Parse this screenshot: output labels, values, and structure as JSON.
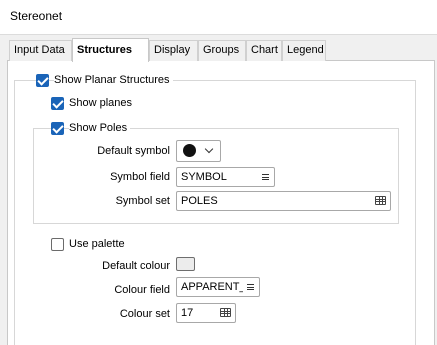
{
  "window": {
    "title": "Stereonet"
  },
  "tabs": [
    {
      "label": "Input Data",
      "active": false
    },
    {
      "label": "Structures",
      "active": true
    },
    {
      "label": "Display",
      "active": false
    },
    {
      "label": "Groups",
      "active": false
    },
    {
      "label": "Chart",
      "active": false
    },
    {
      "label": "Legend",
      "active": false
    }
  ],
  "planar": {
    "show_planar_label": "Show Planar Structures",
    "show_planar_checked": true,
    "show_planes_label": "Show planes",
    "show_planes_checked": true,
    "show_poles_label": "Show Poles",
    "show_poles_checked": true
  },
  "poles": {
    "default_symbol_label": "Default symbol",
    "default_symbol_icon": "filled-circle",
    "symbol_field_label": "Symbol field",
    "symbol_field_value": "SYMBOL",
    "symbol_set_label": "Symbol set",
    "symbol_set_value": "POLES"
  },
  "palette": {
    "use_palette_label": "Use palette",
    "use_palette_checked": false,
    "default_colour_label": "Default colour",
    "default_colour_value": "#ececec",
    "colour_field_label": "Colour field",
    "colour_field_value": "APPARENT_",
    "colour_set_label": "Colour set",
    "colour_set_value": "17"
  }
}
